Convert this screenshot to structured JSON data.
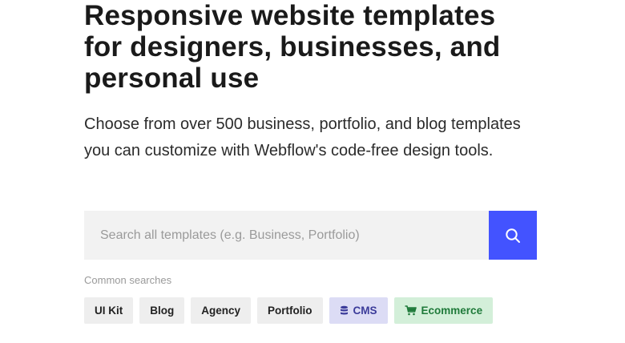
{
  "hero": {
    "headline": "Responsive website templates for designers, businesses, and personal use",
    "subhead": "Choose from over 500 business, portfolio, and blog templates you can customize with Webflow's code-free design tools."
  },
  "search": {
    "placeholder": "Search all templates (e.g. Business, Portfolio)",
    "value": "",
    "button_icon": "search-icon",
    "button_color": "#4353ff"
  },
  "common": {
    "label": "Common searches",
    "tags": [
      {
        "label": "UI Kit",
        "icon": null,
        "bg": "#eeeeee",
        "color": "#222222"
      },
      {
        "label": "Blog",
        "icon": null,
        "bg": "#eeeeee",
        "color": "#222222"
      },
      {
        "label": "Agency",
        "icon": null,
        "bg": "#eeeeee",
        "color": "#222222"
      },
      {
        "label": "Portfolio",
        "icon": null,
        "bg": "#eeeeee",
        "color": "#222222"
      },
      {
        "label": "CMS",
        "icon": "database-icon",
        "bg": "#dcdcf5",
        "color": "#3b3b9a"
      },
      {
        "label": "Ecommerce",
        "icon": "cart-icon",
        "bg": "#d3efd9",
        "color": "#1f7a3a"
      }
    ]
  }
}
